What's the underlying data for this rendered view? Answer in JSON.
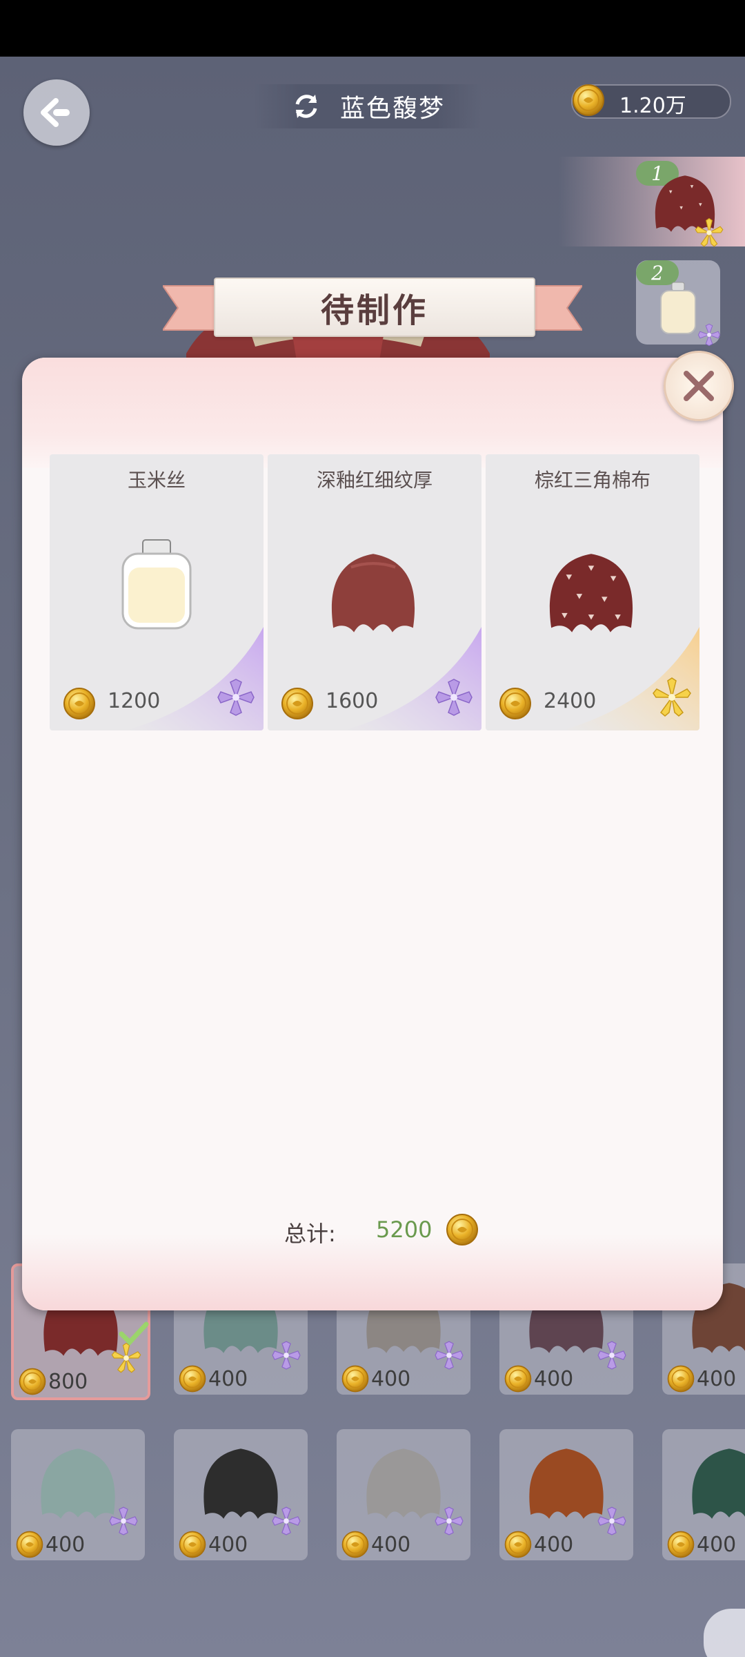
{
  "header": {
    "title": "蓝色馥梦",
    "coins": "1.20万"
  },
  "slots": [
    {
      "badge": "1"
    },
    {
      "badge": "2"
    }
  ],
  "modal": {
    "title": "待制作",
    "items": [
      {
        "name": "玉米丝",
        "price": "1200",
        "rarity": "purple"
      },
      {
        "name": "深釉红细纹厚",
        "price": "1600",
        "rarity": "purple"
      },
      {
        "name": "棕红三角棉布",
        "price": "2400",
        "rarity": "gold"
      }
    ],
    "total_label": "总计:",
    "total_value": "5200"
  },
  "fabrics": [
    {
      "price": "800",
      "color": "#7a2a2a",
      "rarity": "gold",
      "selected": true
    },
    {
      "price": "400",
      "color": "#6b8c88",
      "rarity": "purple"
    },
    {
      "price": "400",
      "color": "#8c8683",
      "rarity": "purple"
    },
    {
      "price": "400",
      "color": "#5e4450",
      "rarity": "purple"
    },
    {
      "price": "400",
      "color": "#6e4436",
      "rarity": "purple"
    },
    {
      "price": "400",
      "color": "#8aa6a2",
      "rarity": "purple"
    },
    {
      "price": "400",
      "color": "#2d2d2d",
      "rarity": "purple"
    },
    {
      "price": "400",
      "color": "#9a9898",
      "rarity": "purple"
    },
    {
      "price": "400",
      "color": "#9a4a22",
      "rarity": "purple"
    },
    {
      "price": "400",
      "color": "#2d5448",
      "rarity": "purple"
    }
  ],
  "colors": {
    "accent_green": "#6a9a4e",
    "coin_gold": "#e8b020",
    "purple_star": "#a987d8",
    "gold_star": "#f1c83a"
  }
}
